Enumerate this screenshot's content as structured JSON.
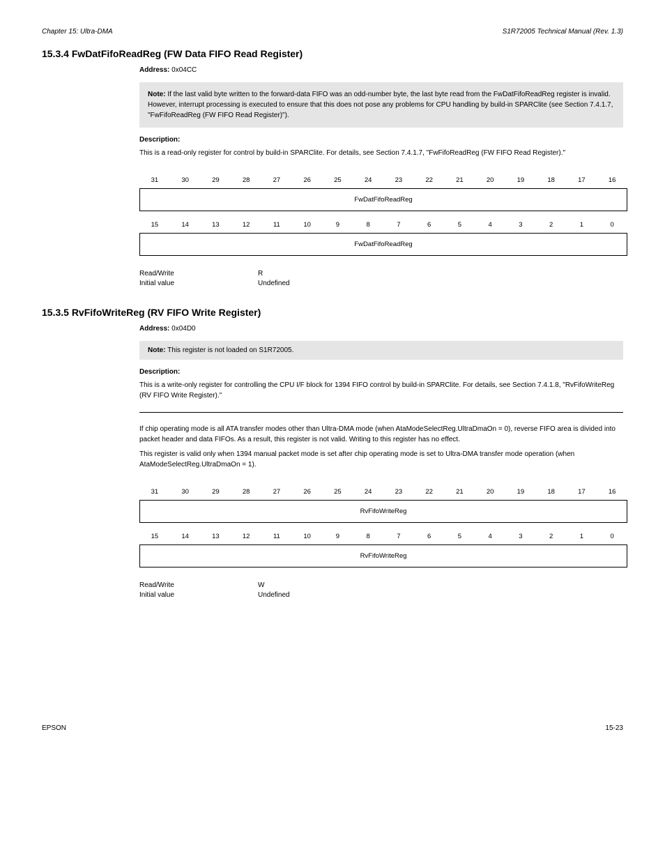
{
  "header": {
    "left": "Chapter 15: Ultra-DMA",
    "right": "S1R72005 Technical Manual (Rev. 1.3)"
  },
  "reg1": {
    "title": "15.3.4 FwDatFifoReadReg (FW Data FIFO Read Register)",
    "address_label": "Address:",
    "address_value": "0x04CC",
    "desc_label": "Description:",
    "desc_text": "This is a read-only register for control by build-in SPARClite. For details, see Section 7.4.1.7, \"FwFifoReadReg (FW FIFO Read Register).\"",
    "note_title": "Note:",
    "note_text": " If the last valid byte written to the forward-data FIFO was an odd-number byte, the last byte read from the FwDatFifoReadReg register is invalid. However, interrupt processing is executed to ensure that this does not pose any problems for CPU handling by build-in SPARClite (see Section 7.4.1.7, \"FwFifoReadReg (FW FIFO Read Register)\").",
    "bits_hi": [
      "31",
      "30",
      "29",
      "28",
      "27",
      "26",
      "25",
      "24",
      "23",
      "22",
      "21",
      "20",
      "19",
      "18",
      "17",
      "16"
    ],
    "field_hi": "FwDatFifoReadReg",
    "bits_lo": [
      "15",
      "14",
      "13",
      "12",
      "11",
      "10",
      "9",
      "8",
      "7",
      "6",
      "5",
      "4",
      "3",
      "2",
      "1",
      "0"
    ],
    "field_lo": "FwDatFifoReadReg",
    "rw_label": "Read/Write",
    "rw_value": "R",
    "iv_label": "Initial value",
    "iv_value": "Undefined"
  },
  "reg2": {
    "title": "15.3.5 RvFifoWriteReg (RV FIFO Write Register)",
    "address_label": "Address:",
    "address_value": "0x04D0",
    "note_title": "Note:",
    "note_text": " This register is not loaded on S1R72005.",
    "desc_label": "Description:",
    "desc_text": "This is a write-only register for controlling the CPU I/F block for 1394 FIFO control by build-in SPARClite. For details, see Section 7.4.1.8, \"RvFifoWriteReg (RV FIFO Write Register).\"",
    "post_text": "If chip operating mode is all ATA transfer modes other than Ultra-DMA mode (when AtaModeSelectReg.UltraDmaOn = 0), reverse FIFO area is divided into packet header and data FIFOs. As a result, this register is not valid. Writing to this register has no effect.",
    "post_text2": "This register is valid only when 1394 manual packet mode is set after chip operating mode is set to Ultra-DMA transfer mode operation (when AtaModeSelectReg.UltraDmaOn = 1).",
    "bits_hi": [
      "31",
      "30",
      "29",
      "28",
      "27",
      "26",
      "25",
      "24",
      "23",
      "22",
      "21",
      "20",
      "19",
      "18",
      "17",
      "16"
    ],
    "field_hi": "RvFifoWriteReg",
    "bits_lo": [
      "15",
      "14",
      "13",
      "12",
      "11",
      "10",
      "9",
      "8",
      "7",
      "6",
      "5",
      "4",
      "3",
      "2",
      "1",
      "0"
    ],
    "field_lo": "RvFifoWriteReg",
    "rw_label": "Read/Write",
    "rw_value": "W",
    "iv_label": "Initial value",
    "iv_value": "Undefined"
  },
  "footer": {
    "left": "EPSON",
    "right": "15-23"
  }
}
